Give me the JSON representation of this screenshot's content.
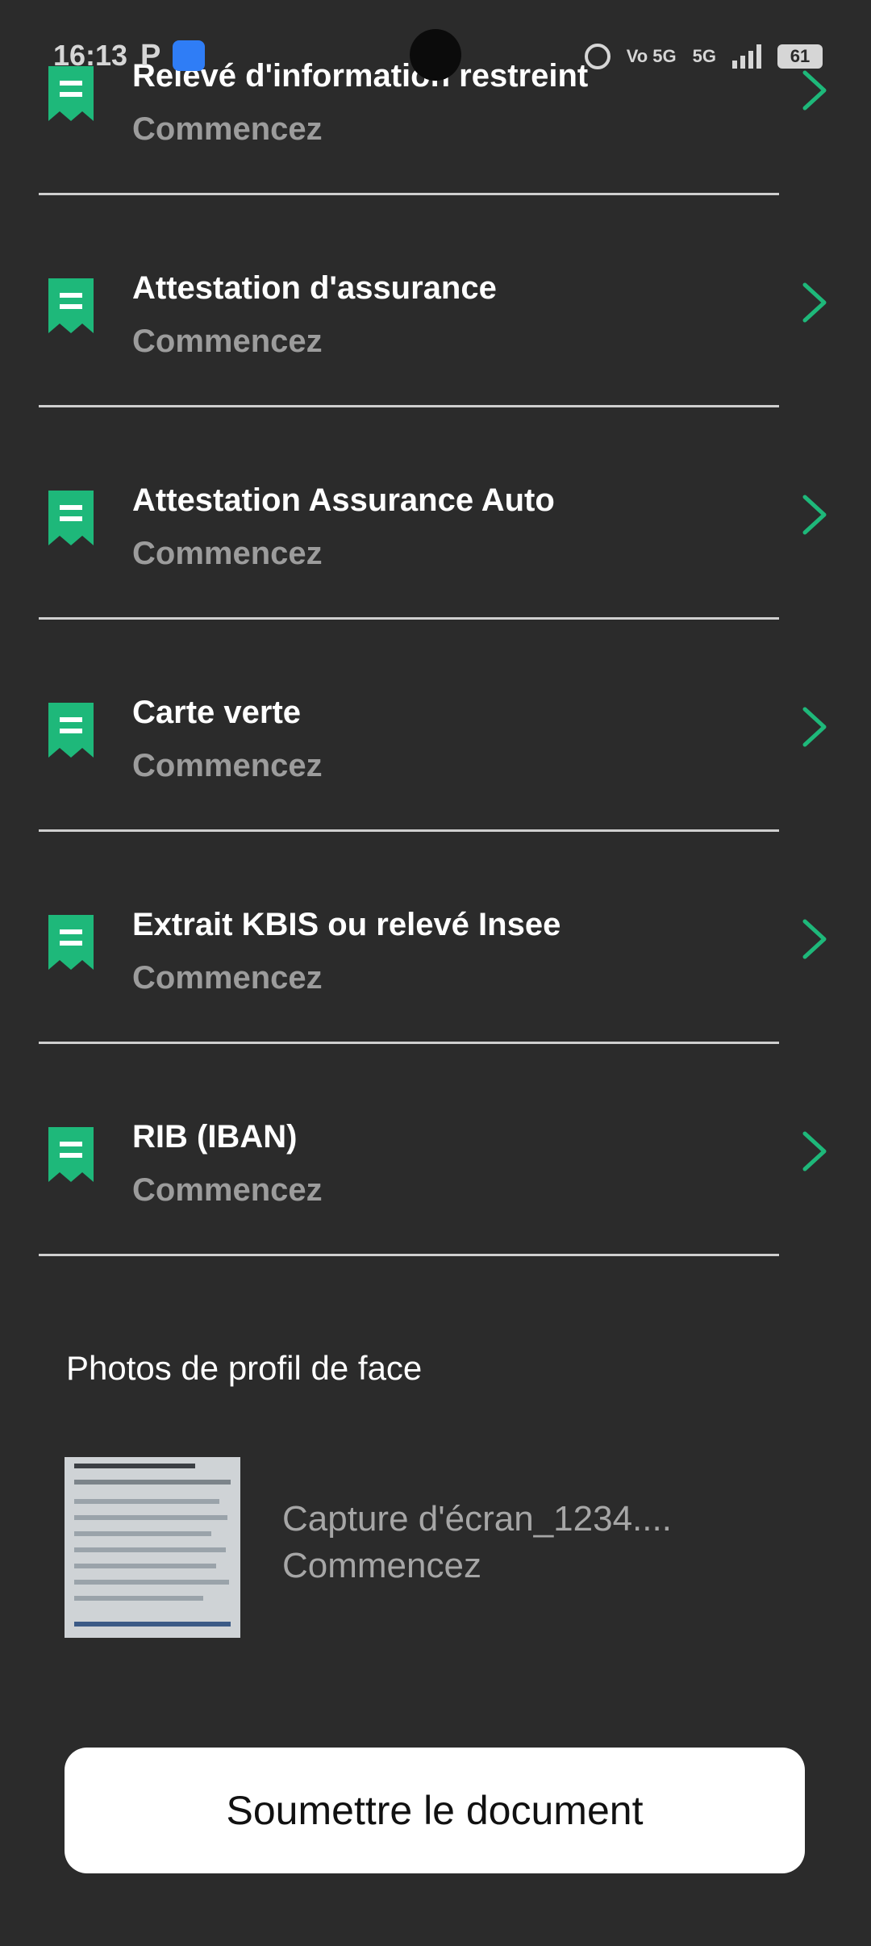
{
  "status_bar": {
    "time": "16:13",
    "indicator_p": "P",
    "network": "5G",
    "volte": "Vo 5G",
    "battery": "61"
  },
  "documents": [
    {
      "title": "Relevé d'information restreint",
      "status": "Commencez"
    },
    {
      "title": "Attestation d'assurance",
      "status": "Commencez"
    },
    {
      "title": "Attestation Assurance Auto",
      "status": "Commencez"
    },
    {
      "title": "Carte verte",
      "status": "Commencez"
    },
    {
      "title": "Extrait KBIS ou relevé Insee",
      "status": "Commencez"
    },
    {
      "title": "RIB (IBAN)",
      "status": "Commencez"
    }
  ],
  "profile_section": {
    "title": "Photos de profil de face",
    "file_name": "Capture d'écran_1234....",
    "status": "Commencez"
  },
  "submit_button": {
    "label": "Soumettre le document"
  },
  "colors": {
    "background": "#2b2b2b",
    "accent": "#1eb87a",
    "divider": "#cfcfcf",
    "muted_text": "#9c9c9c"
  }
}
